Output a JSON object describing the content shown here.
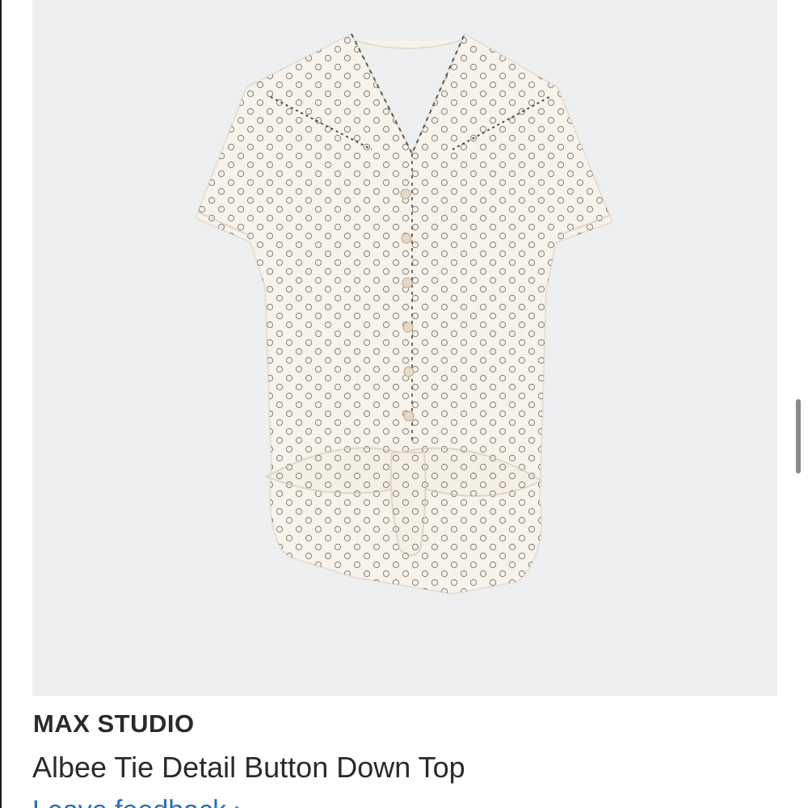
{
  "product": {
    "brand": "MAX STUDIO",
    "name": "Albee Tie Detail Button Down Top",
    "feedback_link": "Leave feedback"
  },
  "colors": {
    "image_background": "#eeeff1",
    "garment": "#f7f3ea",
    "print": "#3a3a3a",
    "link": "#2a6fb8",
    "text": "#2a2a2a"
  },
  "icons": {
    "feedback_chevron": "chevron-right-icon"
  }
}
